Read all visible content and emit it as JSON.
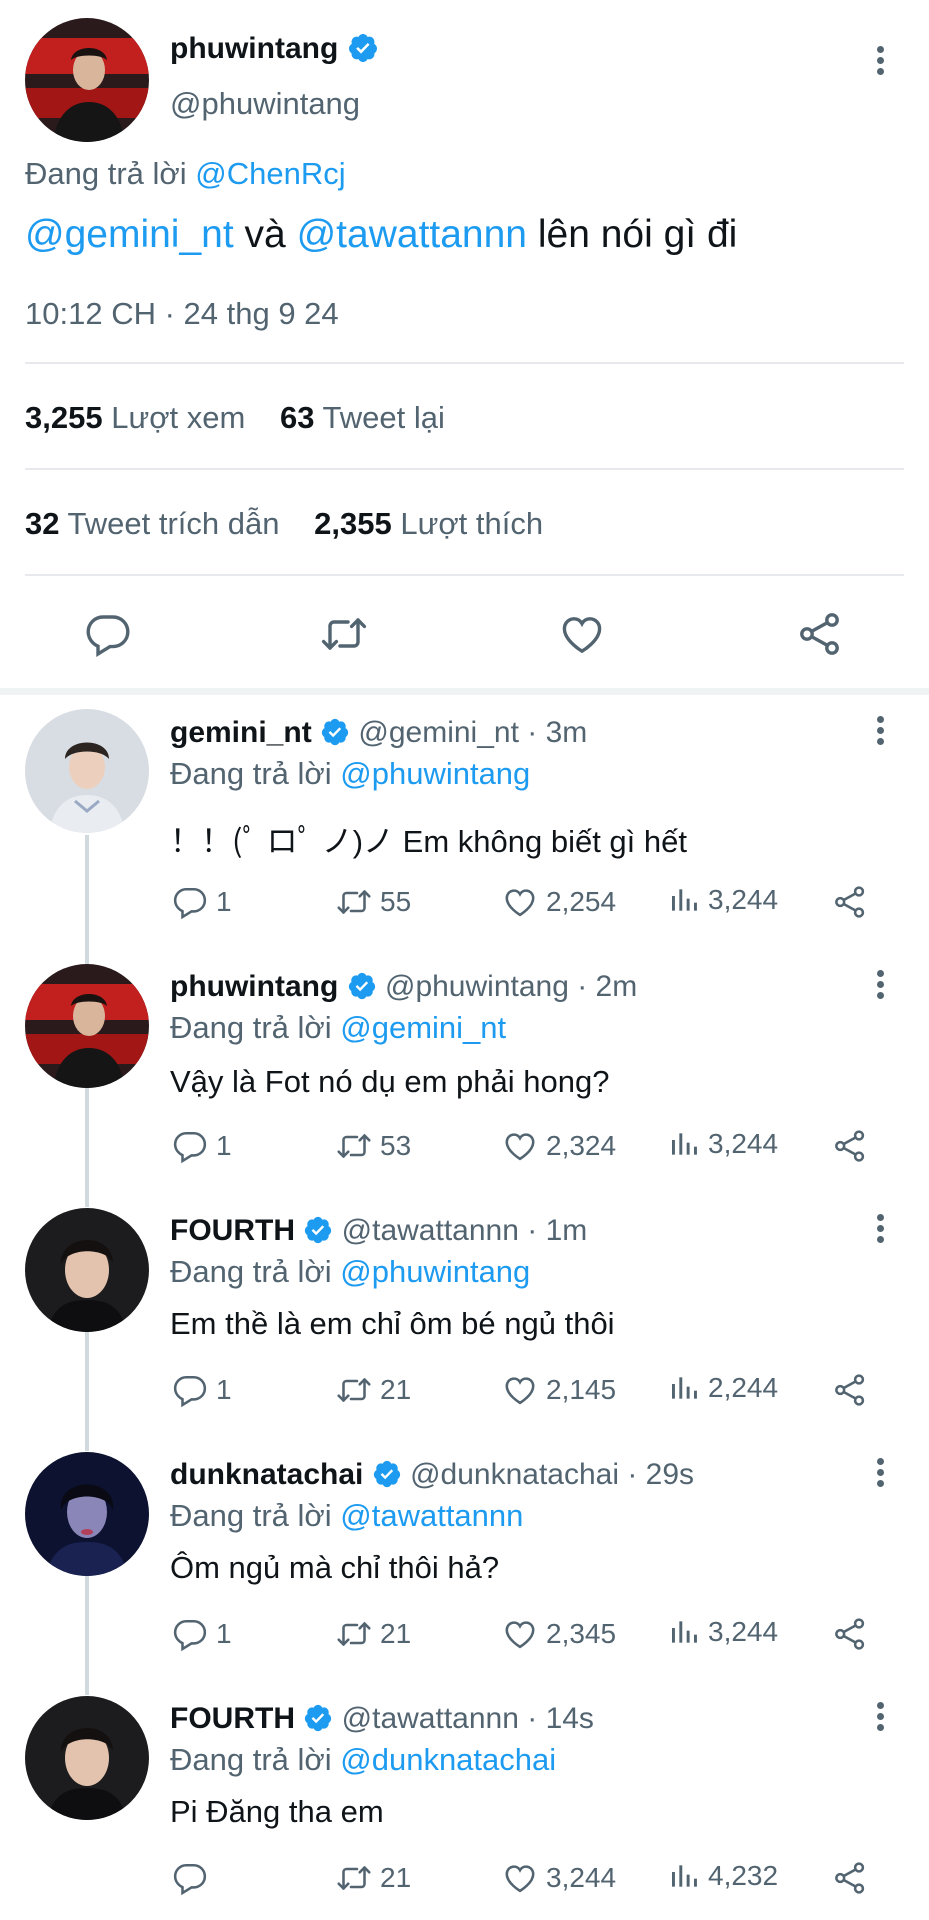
{
  "main_tweet": {
    "display_name": "phuwintang",
    "handle": "@phuwintang",
    "replying_prefix": "Đang trả lời",
    "replying_to": "@ChenRcj",
    "mention_1": "@gemini_nt",
    "text_and": "và",
    "mention_2": "@tawattannn",
    "text_rest": "lên nói gì đi",
    "timestamp": "10:12 CH · 24 thg 9 24",
    "views_count": "3,255",
    "views_label": "Lượt xem",
    "retweets_count": "63",
    "retweets_label": "Tweet lại",
    "quotes_count": "32",
    "quotes_label": "Tweet trích dẫn",
    "likes_count": "2,355",
    "likes_label": "Lượt thích"
  },
  "replies": [
    {
      "display_name": "gemini_nt",
      "handle_time": "@gemini_nt · 3m",
      "replying_prefix": "Đang trả lời",
      "replying_to": "@phuwintang",
      "text": "！！(ﾟ ロﾟ ノ)ノ Em không biết gì hết",
      "replies": "1",
      "retweets": "55",
      "likes": "2,254",
      "views": "3,244"
    },
    {
      "display_name": "phuwintang",
      "handle_time": "@phuwintang · 2m",
      "replying_prefix": "Đang trả lời",
      "replying_to": "@gemini_nt",
      "text": "Vậy là Fot nó dụ em phải hong?",
      "replies": "1",
      "retweets": "53",
      "likes": "2,324",
      "views": "3,244"
    },
    {
      "display_name": "FOURTH",
      "handle_time": "@tawattannn · 1m",
      "replying_prefix": "Đang trả lời",
      "replying_to": "@phuwintang",
      "text": "Em thề là em chỉ ôm bé ngủ thôi",
      "replies": "1",
      "retweets": "21",
      "likes": "2,145",
      "views": "2,244"
    },
    {
      "display_name": "dunknatachai",
      "handle_time": "@dunknatachai · 29s",
      "replying_prefix": "Đang trả lời",
      "replying_to": "@tawattannn",
      "text": "Ôm ngủ mà chỉ thôi hả?",
      "replies": "1",
      "retweets": "21",
      "likes": "2,345",
      "views": "3,244"
    },
    {
      "display_name": "FOURTH",
      "handle_time": "@tawattannn · 14s",
      "replying_prefix": "Đang trả lời",
      "replying_to": "@dunknatachai",
      "text": "Pi Đăng tha em",
      "replies": "",
      "retweets": "21",
      "likes": "3,244",
      "views": "4,232"
    }
  ],
  "colors": {
    "accent": "#1d9bf0",
    "secondary_text": "#536471",
    "divider": "#e7e9ec"
  },
  "icons": [
    "verified-badge-icon",
    "more-icon",
    "reply-icon",
    "retweet-icon",
    "like-icon",
    "share-icon",
    "views-icon"
  ]
}
